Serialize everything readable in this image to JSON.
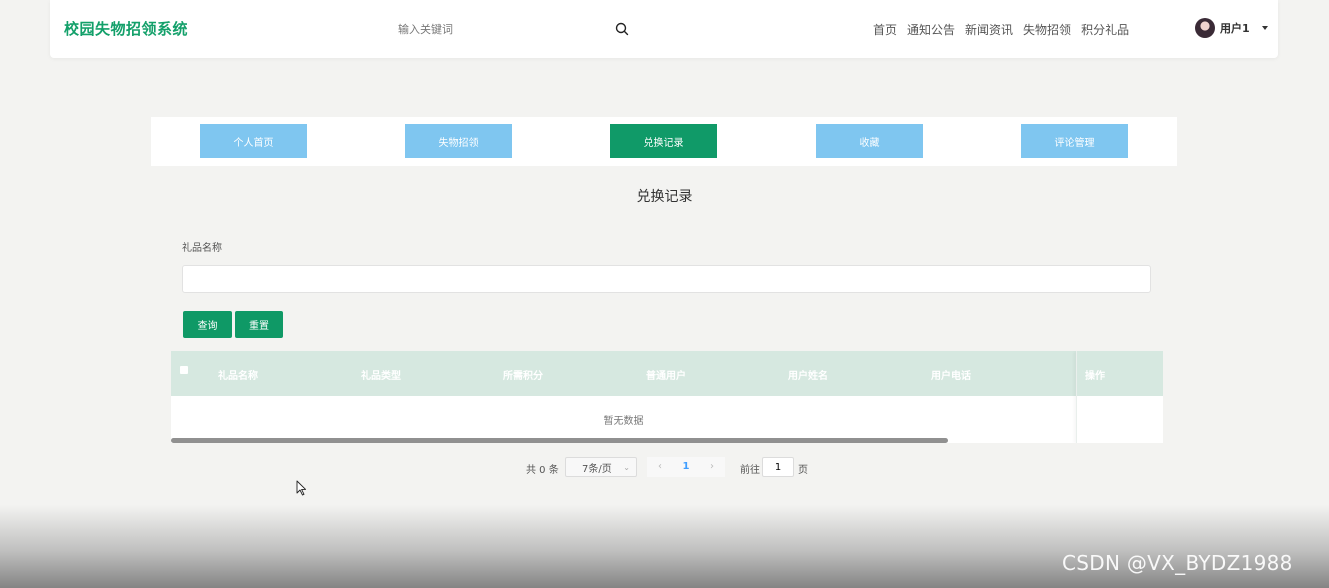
{
  "header": {
    "logo": "校园失物招领系统",
    "search_placeholder": "输入关键词",
    "nav": [
      "首页",
      "通知公告",
      "新闻资讯",
      "失物招领",
      "积分礼品"
    ],
    "username": "用户1"
  },
  "tabs": [
    {
      "label": "个人首页",
      "active": false
    },
    {
      "label": "失物招领",
      "active": false
    },
    {
      "label": "兑换记录",
      "active": true
    },
    {
      "label": "收藏",
      "active": false
    },
    {
      "label": "评论管理",
      "active": false
    }
  ],
  "page_title": "兑换记录",
  "filter": {
    "label": "礼品名称",
    "value": "",
    "search_button": "查询",
    "reset_button": "重置"
  },
  "table": {
    "columns": [
      "礼品名称",
      "礼品类型",
      "所需积分",
      "普通用户",
      "用户姓名",
      "用户电话"
    ],
    "action_column": "操作",
    "empty_text": "暂无数据"
  },
  "pagination": {
    "total": "共 0 条",
    "page_size": "7条/页",
    "current_page": "1",
    "goto_label": "前往",
    "goto_value": "1",
    "page_unit": "页"
  },
  "watermark": "CSDN @VX_BYDZ1988",
  "colors": {
    "brand_green": "#109a68",
    "tab_blue": "#7fc6f0",
    "table_header": "#d6e8e0"
  }
}
